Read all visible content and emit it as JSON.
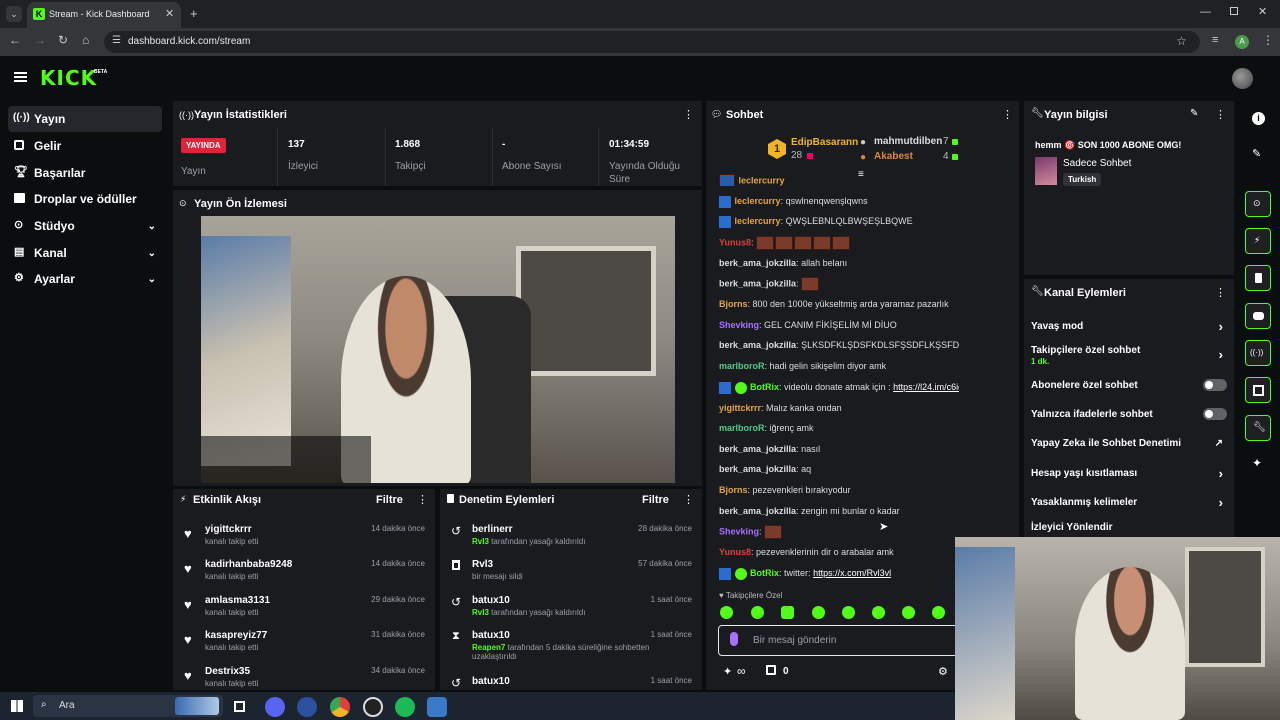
{
  "browser": {
    "tab_title": "Stream - Kick Dashboard",
    "url": "dashboard.kick.com/stream",
    "profile_initial": "A"
  },
  "brand": {
    "logo": "KICK",
    "beta": "BETA",
    "accent": "#53fc18"
  },
  "sidebar": {
    "items": [
      {
        "label": "Yayın",
        "icon": "broadcast-icon",
        "active": true
      },
      {
        "label": "Gelir",
        "icon": "revenue-icon"
      },
      {
        "label": "Başarılar",
        "icon": "trophy-icon"
      },
      {
        "label": "Droplar ve ödüller",
        "icon": "gift-icon"
      },
      {
        "label": "Stüdyo",
        "icon": "studio-icon"
      },
      {
        "label": "Kanal",
        "icon": "channel-icon"
      },
      {
        "label": "Ayarlar",
        "icon": "settings-icon"
      }
    ]
  },
  "stats": {
    "title": "Yayın İstatistikleri",
    "live_badge": "YAYINDA",
    "live_label": "Yayın",
    "viewers_value": "137",
    "viewers_label": "İzleyici",
    "followers_value": "1.868",
    "followers_label": "Takipçi",
    "subs_value": "-",
    "subs_label": "Abone Sayısı",
    "uptime_value": "01:34:59",
    "uptime_label": "Yayında Olduğu Süre"
  },
  "preview": {
    "title": "Yayın Ön İzlemesi"
  },
  "activity": {
    "title": "Etkinlik Akışı",
    "filter": "Filtre",
    "events": [
      {
        "name": "yigittckrrr",
        "sub": "kanalı takip etti",
        "time": "14 dakika önce"
      },
      {
        "name": "kadirhanbaba9248",
        "sub": "kanalı takip etti",
        "time": "14 dakika önce"
      },
      {
        "name": "amlasma3131",
        "sub": "kanalı takip etti",
        "time": "29 dakika önce"
      },
      {
        "name": "kasapreyiz77",
        "sub": "kanalı takip etti",
        "time": "31 dakika önce"
      },
      {
        "name": "Destrix35",
        "sub": "kanalı takip etti",
        "time": "34 dakika önce"
      }
    ]
  },
  "moderation": {
    "title": "Denetim Eylemleri",
    "filter": "Filtre",
    "events": [
      {
        "name": "berlinerr",
        "actor": "Rvl3",
        "sub": "tarafından yasağı kaldırıldı",
        "time": "28 dakika önce"
      },
      {
        "name": "Rvl3",
        "actor": "",
        "sub": "bir mesajı sildi",
        "time": "57 dakika önce"
      },
      {
        "name": "batux10",
        "actor": "Rvl3",
        "sub": "tarafından yasağı kaldırıldı",
        "time": "1 saat önce"
      },
      {
        "name": "batux10",
        "actor": "Reapen7",
        "sub": "tarafından 5 dakika süreliğine sohbetten",
        "sub2": "uzaklaştırıldı",
        "time": "1 saat önce"
      },
      {
        "name": "batux10",
        "actor": "",
        "sub": "",
        "time": "1 saat önce"
      }
    ]
  },
  "chat": {
    "title": "Sohbet",
    "top": {
      "rank": "1",
      "first_name": "EdipBasarann",
      "first_count": "28",
      "second_name": "mahmutdilben",
      "second_count": "7",
      "third_name": "Akabest",
      "third_count": "4"
    },
    "messages": [
      {
        "user": "leclercurry",
        "color": "#e6a53c",
        "text": "qswlnenqwenşlqwns"
      },
      {
        "user": "leclercurry",
        "color": "#e6a53c",
        "text": "QWŞLEBNLQLBWŞEŞLBQWE"
      },
      {
        "user": "Yunus8",
        "color": "#e0403c",
        "text": "",
        "emotes": 5
      },
      {
        "user": "berk_ama_jokzilla",
        "color": "#dddddd",
        "text": "allah belanı"
      },
      {
        "user": "berk_ama_jokzilla",
        "color": "#dddddd",
        "text": "",
        "emotes": 1
      },
      {
        "user": "Bjorns",
        "color": "#e6a53c",
        "text": "800 den 1000e yükseltmiş arda yaramaz pazarlık"
      },
      {
        "user": "Shevking",
        "color": "#a970ff",
        "text": "GEL CANIM FİKİŞELİM Mİ DİUO"
      },
      {
        "user": "berk_ama_jokzilla",
        "color": "#dddddd",
        "text": "ŞLKSDFKLŞDSFKDLSFŞSDFLKŞSFD"
      },
      {
        "user": "marlboroR",
        "color": "#53c98a",
        "text": "hadi gelin sikişelim diyor amk"
      },
      {
        "user": "BotRix",
        "color": "#53fc18",
        "text": "videolu donate atmak için :",
        "link": "https://l24.im/c6io"
      },
      {
        "user": "yigittckrrr",
        "color": "#e6a53c",
        "text": "Malız kanka ondan"
      },
      {
        "user": "marlboroR",
        "color": "#53c98a",
        "text": "iğrenç amk"
      },
      {
        "user": "berk_ama_jokzilla",
        "color": "#dddddd",
        "text": "nasıl"
      },
      {
        "user": "berk_ama_jokzilla",
        "color": "#dddddd",
        "text": "aq"
      },
      {
        "user": "Bjorns",
        "color": "#e6a53c",
        "text": "pezevenkleri bırakıyodur"
      },
      {
        "user": "berk_ama_jokzilla",
        "color": "#dddddd",
        "text": "zengin mi bunlar o kadar"
      },
      {
        "user": "Shevking",
        "color": "#a970ff",
        "text": "",
        "emotes": 1
      },
      {
        "user": "Yunus8",
        "color": "#e0403c",
        "text": "pezevenklerinin dir o arabalar amk"
      },
      {
        "user": "BotRix",
        "color": "#53fc18",
        "text": "twitter:",
        "link": "https://x.com/Rvl3vl"
      }
    ],
    "mode_label": "Takipçilere Özel",
    "input_placeholder": "Bir mesaj gönderin",
    "points": "∞",
    "gift_count": "0"
  },
  "stream_info": {
    "title": "Yayın bilgisi",
    "stream_title": "hemm 🎯 SON 1000 ABONE OMG!",
    "category": "Sadece Sohbet",
    "tag": "Turkish"
  },
  "channel_actions": {
    "title": "Kanal Eylemleri",
    "items": [
      {
        "label": "Yavaş mod",
        "type": "arrow"
      },
      {
        "label": "Takipçilere özel sohbet",
        "sub": "1 dk.",
        "type": "arrow"
      },
      {
        "label": "Abonelere özel sohbet",
        "type": "toggle"
      },
      {
        "label": "Yalnızca ifadelerle sohbet",
        "type": "toggle"
      },
      {
        "label": "Yapay Zeka ile Sohbet Denetimi",
        "type": "external"
      },
      {
        "label": "Hesap yaşı kısıtlaması",
        "type": "arrow"
      },
      {
        "label": "Yasaklanmış kelimeler",
        "type": "arrow"
      },
      {
        "label": "İzleyici Yönlendir",
        "type": "none"
      }
    ]
  },
  "taskbar": {
    "search_placeholder": "Ara"
  }
}
